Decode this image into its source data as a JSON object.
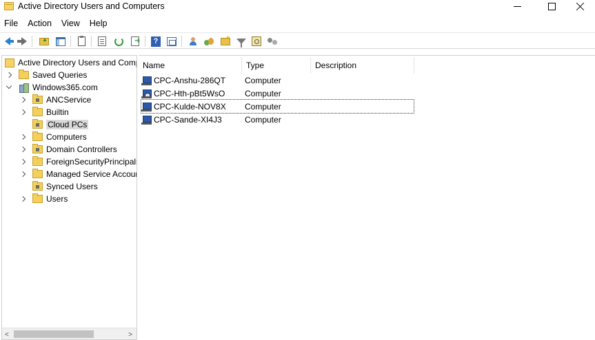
{
  "window": {
    "title": "Active Directory Users and Computers"
  },
  "menu": [
    "File",
    "Action",
    "View",
    "Help"
  ],
  "toolbar": {
    "icons": [
      "back-arrow-icon",
      "forward-arrow-icon",
      "up-folder-icon",
      "show-hide-console-tree-icon",
      "clipboard-icon",
      "properties-icon",
      "refresh-icon",
      "export-list-icon",
      "help-icon",
      "console-view-icon",
      "new-user-icon",
      "new-group-icon",
      "new-ou-icon",
      "filter-icon",
      "find-icon",
      "delegate-control-icon"
    ]
  },
  "tree": {
    "root": "Active Directory Users and Computers",
    "saved_queries": "Saved Queries",
    "domain": "Windows365.com",
    "children": [
      {
        "label": "ANCService",
        "expandable": true
      },
      {
        "label": "Builtin",
        "expandable": true
      },
      {
        "label": "Cloud PCs",
        "expandable": false,
        "selected": true
      },
      {
        "label": "Computers",
        "expandable": true
      },
      {
        "label": "Domain Controllers",
        "expandable": true
      },
      {
        "label": "ForeignSecurityPrincipals",
        "expandable": true
      },
      {
        "label": "Managed Service Accounts",
        "expandable": true
      },
      {
        "label": "Synced Users",
        "expandable": false
      },
      {
        "label": "Users",
        "expandable": true
      }
    ]
  },
  "list": {
    "columns": [
      "Name",
      "Type",
      "Description"
    ],
    "rows": [
      {
        "name": "CPC-Anshu-286QT",
        "type": "Computer",
        "description": "",
        "disabled": false
      },
      {
        "name": "CPC-Hth-pBt5WsO",
        "type": "Computer",
        "description": "",
        "disabled": true
      },
      {
        "name": "CPC-Kulde-NOV8X",
        "type": "Computer",
        "description": "",
        "disabled": false,
        "focused": true
      },
      {
        "name": "CPC-Sande-XI4J3",
        "type": "Computer",
        "description": "",
        "disabled": false
      }
    ]
  },
  "scrollbar": {
    "left": "<",
    "right": ">"
  }
}
